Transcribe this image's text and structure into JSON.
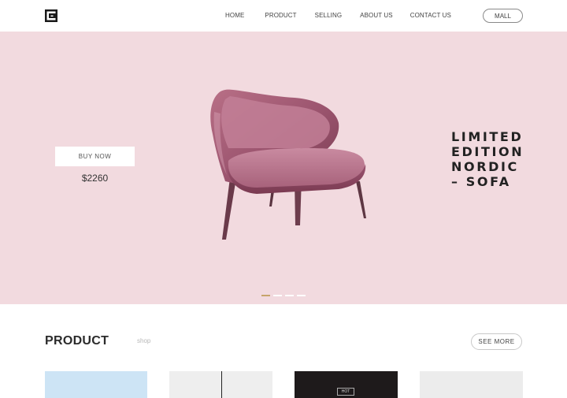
{
  "header": {
    "logo_icon": "square-logo-icon",
    "nav": [
      "HOME",
      "PRODUCT",
      "SELLING",
      "ABOUT US",
      "CONTACT US"
    ],
    "mall_label": "MALL"
  },
  "hero": {
    "background": "#f2dadf",
    "buy_label": "BUY NOW",
    "price": "$2260",
    "title_lines": [
      "LIMITED",
      "EDITION",
      "NORDIC",
      "–  SOFA"
    ],
    "image": "pink-velvet-armchair",
    "slider": {
      "count": 4,
      "active": 1,
      "active_color": "#c7a46b"
    }
  },
  "products": {
    "title": "PRODUCT",
    "tag": "shop",
    "see_more_label": "SEE MORE",
    "cards": [
      {
        "color": "#cde4f5"
      },
      {
        "color": "#eeeeee"
      },
      {
        "color": "#1e1a1b",
        "badge": "HOT"
      },
      {
        "color": "#ececec"
      }
    ]
  }
}
